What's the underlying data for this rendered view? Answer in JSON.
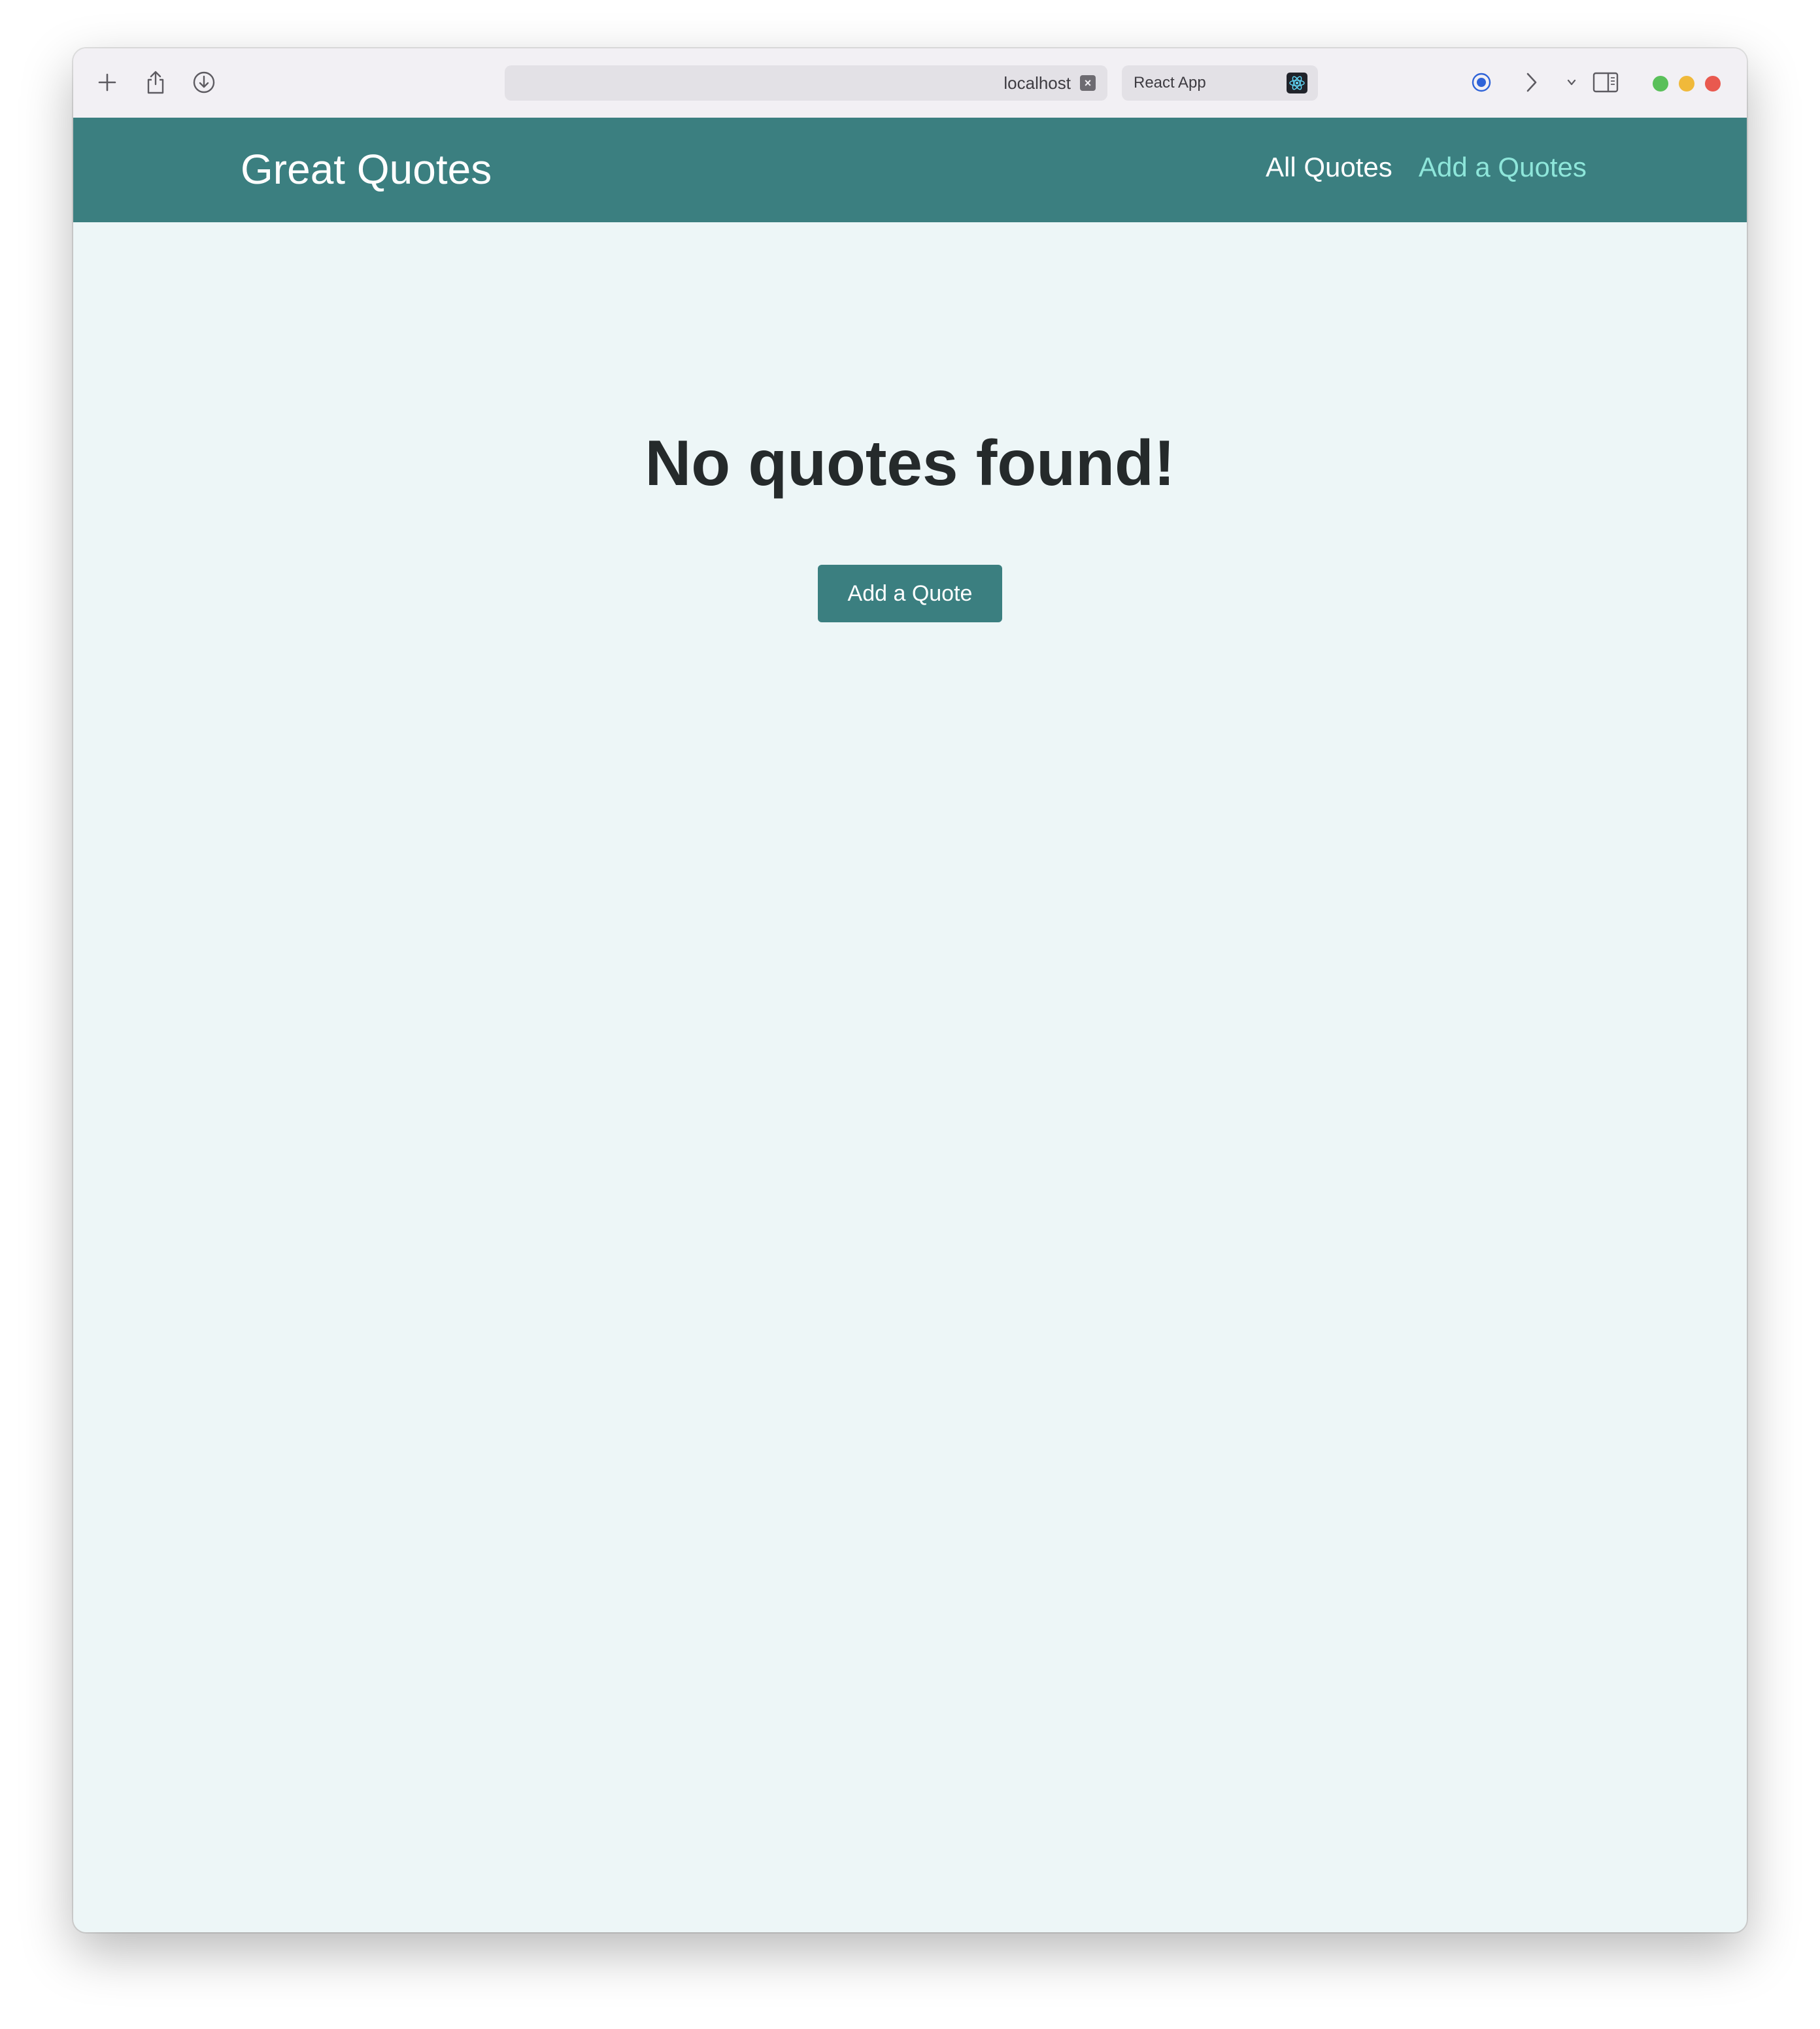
{
  "browser": {
    "address_text": "localhost",
    "tab_title": "React App",
    "icons": [
      "plus-icon",
      "share-icon",
      "download-icon",
      "record-icon",
      "chevron-right-icon",
      "chevron-down-icon",
      "sidebar-icon"
    ],
    "traffic_colors": {
      "green": "#5ac05a",
      "yellow": "#f0b93a",
      "red": "#e9594f"
    }
  },
  "header": {
    "brand": "Great Quotes",
    "nav": {
      "all_quotes": "All Quotes",
      "add_quotes": "Add a Quotes"
    },
    "background": "#3b7f80",
    "active_link_color": "#8ee6da"
  },
  "main": {
    "heading": "No quotes found!",
    "add_button": "Add a Quote",
    "background": "#edf6f7"
  }
}
